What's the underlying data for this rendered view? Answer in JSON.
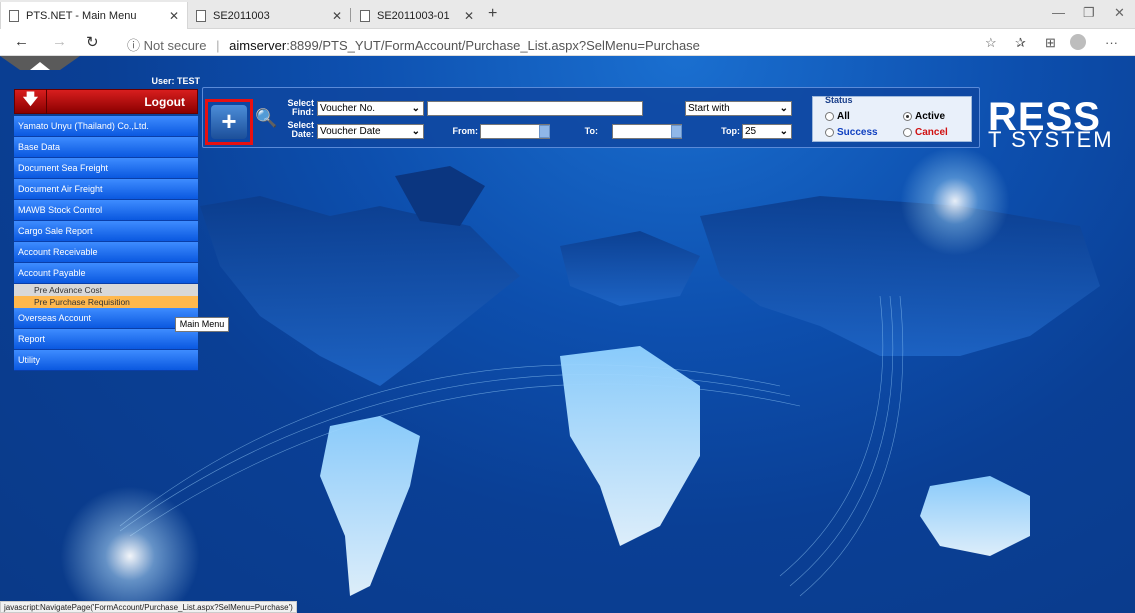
{
  "browser": {
    "tabs": [
      {
        "label": "PTS.NET - Main Menu"
      },
      {
        "label": "SE2011003"
      },
      {
        "label": "SE2011003-01"
      }
    ],
    "address": {
      "not_secure": "Not secure",
      "host": "aimserver",
      "path": ":8899/PTS_YUT/FormAccount/Purchase_List.aspx?SelMenu=Purchase"
    }
  },
  "header": {
    "user_label": "User: TEST",
    "logout_label": "Logout"
  },
  "menu": {
    "items": [
      {
        "label": "Yamato Unyu (Thailand) Co.,Ltd."
      },
      {
        "label": "Base Data"
      },
      {
        "label": "Document Sea Freight"
      },
      {
        "label": "Document Air Freight"
      },
      {
        "label": "MAWB Stock Control"
      },
      {
        "label": "Cargo Sale Report"
      },
      {
        "label": "Account Receivable"
      },
      {
        "label": "Account Payable"
      },
      {
        "label": "Overseas Account"
      },
      {
        "label": "Report"
      },
      {
        "label": "Utility"
      }
    ],
    "subitems": [
      {
        "label": "Pre Advance Cost"
      },
      {
        "label": "Pre Purchase Requisition"
      }
    ],
    "tooltip": "Main Menu"
  },
  "search": {
    "select_find_label_1": "Select",
    "select_find_label_2": "Find:",
    "select_find_value": "Voucher No.",
    "find_mode": "Start with",
    "select_date_label_1": "Select",
    "select_date_label_2": "Date:",
    "select_date_value": "Voucher Date",
    "from_label": "From:",
    "to_label": "To:",
    "top_label": "Top:",
    "top_value": "25"
  },
  "status": {
    "legend": "Status",
    "all": "All",
    "active": "Active",
    "success": "Success",
    "cancel": "Cancel"
  },
  "brand": {
    "line1": "RESS",
    "line2": "T SYSTEM"
  },
  "statusbar": "javascript:NavigatePage('FormAccount/Purchase_List.aspx?SelMenu=Purchase')"
}
